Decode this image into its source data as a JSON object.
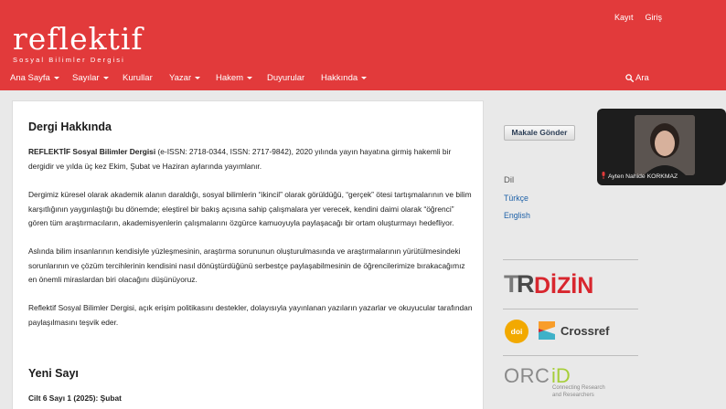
{
  "header": {
    "user_links": {
      "register": "Kayıt",
      "login": "Giriş"
    },
    "logo": {
      "word": "reflektif",
      "subtitle": "Sosyal Bilimler Dergisi"
    },
    "nav": [
      {
        "label": "Ana Sayfa",
        "dropdown": true
      },
      {
        "label": "Sayılar",
        "dropdown": true
      },
      {
        "label": "Kurullar",
        "dropdown": false
      },
      {
        "label": "Yazar",
        "dropdown": true
      },
      {
        "label": "Hakem",
        "dropdown": true
      },
      {
        "label": "Duyurular",
        "dropdown": false
      },
      {
        "label": "Hakkında",
        "dropdown": true
      }
    ],
    "search_label": "Ara"
  },
  "main": {
    "about_title": "Dergi Hakkında",
    "p1_bold": "REFLEKTİF Sosyal Bilimler Dergisi",
    "p1_rest": " (e-ISSN: 2718-0344, ISSN: 2717-9842), 2020 yılında yayın hayatına girmiş hakemli bir dergidir ve yılda üç kez Ekim, Şubat ve Haziran aylarında yayımlanır.",
    "p2": "Dergimiz küresel olarak akademik alanın daraldığı, sosyal bilimlerin “ikincil” olarak görüldüğü, “gerçek” ötesi tartışmalarının ve bilim karşıtlığının yaygınlaştığı bu dönemde; eleştirel bir bakış açısına sahip çalışmalara yer verecek, kendini daimi olarak  “öğrenci” gören tüm araştırmacıların, akademisyenlerin çalışmalarını özgürce kamuoyuyla paylaşacağı bir ortam oluşturmayı hedefliyor.",
    "p3": "Aslında bilim insanlarının kendisiyle yüzleşmesinin, araştırma sorununun oluşturulmasında ve araştırmalarının yürütülmesindeki sorunlarının ve çözüm tercihlerinin kendisini nasıl dönüştürdüğünü serbestçe paylaşabilmesinin de öğrencilerimize bırakacağımız en önemli miraslardan biri olacağını düşünüyoruz.",
    "p4": "Reflektif Sosyal Bilimler Dergisi, açık erişim politikasını destekler, dolayısıyla yayınlanan yazıların yazarlar ve okuyucular tarafından paylaşılmasını teşvik eder.",
    "new_issue_title": "Yeni Sayı",
    "issue_line": "Cilt 6 Sayı 1 (2025): Şubat"
  },
  "sidebar": {
    "submit_button": "Makale Gönder",
    "language_heading": "Dil",
    "languages": [
      "Türkçe",
      "English"
    ],
    "indexes": {
      "trdizin": "TR DİZİN",
      "doi": "doi",
      "crossref": "Crossref",
      "orcid": "ORCID",
      "orcid_tagline_1": "Connecting Research",
      "orcid_tagline_2": "and Researchers"
    }
  },
  "video_overlay": {
    "participant_name": "Ayten Nahide KORKMAZ"
  },
  "colors": {
    "brand_red": "#e23a3b",
    "link_blue": "#1e61a8",
    "doi_orange": "#f2a900",
    "orcid_green": "#a6ce39"
  },
  "icons": [
    "caret-down-icon",
    "search-icon",
    "microphone-muted-icon",
    "doi-badge-icon",
    "crossref-icon",
    "orcid-icon"
  ]
}
